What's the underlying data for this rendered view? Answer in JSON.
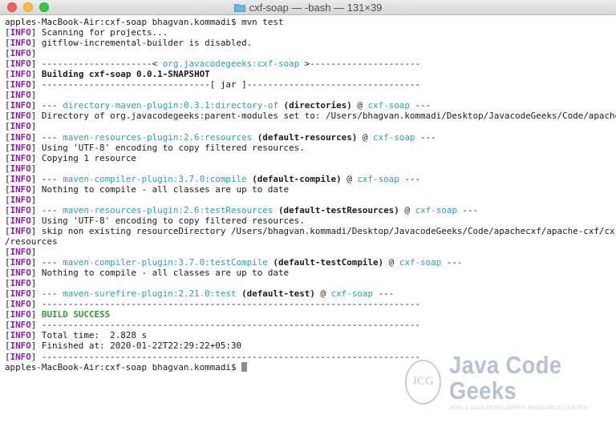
{
  "window": {
    "title": "cxf-soap — -bash — 131×39"
  },
  "terminal": {
    "lines": [
      [
        {
          "t": "apples-MacBook-Air:cxf-soap bhagvan.kommadi$ mvn test"
        }
      ],
      [
        {
          "t": "[",
          "c": "tag"
        },
        {
          "t": "INFO",
          "c": "tagb"
        },
        {
          "t": "] Scanning for projects..."
        }
      ],
      [
        {
          "t": "[",
          "c": "tag"
        },
        {
          "t": "INFO",
          "c": "tagb"
        },
        {
          "t": "] gitflow-incremental-builder is disabled."
        }
      ],
      [
        {
          "t": "[",
          "c": "tag"
        },
        {
          "t": "INFO",
          "c": "tagb"
        },
        {
          "t": "]"
        }
      ],
      [
        {
          "t": "[",
          "c": "tag"
        },
        {
          "t": "INFO",
          "c": "tagb"
        },
        {
          "t": "] ---------------------< "
        },
        {
          "t": "org.javacodegeeks:cxf-soap",
          "c": "cyan"
        },
        {
          "t": " >---------------------"
        }
      ],
      [
        {
          "t": "[",
          "c": "tag"
        },
        {
          "t": "INFO",
          "c": "tagb"
        },
        {
          "t": "] "
        },
        {
          "t": "Building cxf-soap 0.0.1-SNAPSHOT",
          "c": "bold"
        }
      ],
      [
        {
          "t": "[",
          "c": "tag"
        },
        {
          "t": "INFO",
          "c": "tagb"
        },
        {
          "t": "] --------------------------------[ jar ]---------------------------------"
        }
      ],
      [
        {
          "t": "[",
          "c": "tag"
        },
        {
          "t": "INFO",
          "c": "tagb"
        },
        {
          "t": "]"
        }
      ],
      [
        {
          "t": "[",
          "c": "tag"
        },
        {
          "t": "INFO",
          "c": "tagb"
        },
        {
          "t": "] --- "
        },
        {
          "t": "directory-maven-plugin:0.3.1:directory-of",
          "c": "cyan"
        },
        {
          "t": " "
        },
        {
          "t": "(directories)",
          "c": "bold"
        },
        {
          "t": " @ "
        },
        {
          "t": "cxf-soap",
          "c": "cyan"
        },
        {
          "t": " ---"
        }
      ],
      [
        {
          "t": "[",
          "c": "tag"
        },
        {
          "t": "INFO",
          "c": "tagb"
        },
        {
          "t": "] Directory of org.javacodegeeks:parent-modules set to: /Users/bhagvan.kommadi/Desktop/JavacodeGeeks/Code/apache"
        }
      ],
      [
        {
          "t": "[",
          "c": "tag"
        },
        {
          "t": "INFO",
          "c": "tagb"
        },
        {
          "t": "]"
        }
      ],
      [
        {
          "t": "[",
          "c": "tag"
        },
        {
          "t": "INFO",
          "c": "tagb"
        },
        {
          "t": "] --- "
        },
        {
          "t": "maven-resources-plugin:2.6:resources",
          "c": "cyan"
        },
        {
          "t": " "
        },
        {
          "t": "(default-resources)",
          "c": "bold"
        },
        {
          "t": " @ "
        },
        {
          "t": "cxf-soap",
          "c": "cyan"
        },
        {
          "t": " ---"
        }
      ],
      [
        {
          "t": "[",
          "c": "tag"
        },
        {
          "t": "INFO",
          "c": "tagb"
        },
        {
          "t": "] Using 'UTF-8' encoding to copy filtered resources."
        }
      ],
      [
        {
          "t": "[",
          "c": "tag"
        },
        {
          "t": "INFO",
          "c": "tagb"
        },
        {
          "t": "] Copying 1 resource"
        }
      ],
      [
        {
          "t": "[",
          "c": "tag"
        },
        {
          "t": "INFO",
          "c": "tagb"
        },
        {
          "t": "]"
        }
      ],
      [
        {
          "t": "[",
          "c": "tag"
        },
        {
          "t": "INFO",
          "c": "tagb"
        },
        {
          "t": "] --- "
        },
        {
          "t": "maven-compiler-plugin:3.7.0:compile",
          "c": "cyan"
        },
        {
          "t": " "
        },
        {
          "t": "(default-compile)",
          "c": "bold"
        },
        {
          "t": " @ "
        },
        {
          "t": "cxf-soap",
          "c": "cyan"
        },
        {
          "t": " ---"
        }
      ],
      [
        {
          "t": "[",
          "c": "tag"
        },
        {
          "t": "INFO",
          "c": "tagb"
        },
        {
          "t": "] Nothing to compile - all classes are up to date"
        }
      ],
      [
        {
          "t": "[",
          "c": "tag"
        },
        {
          "t": "INFO",
          "c": "tagb"
        },
        {
          "t": "]"
        }
      ],
      [
        {
          "t": "[",
          "c": "tag"
        },
        {
          "t": "INFO",
          "c": "tagb"
        },
        {
          "t": "] --- "
        },
        {
          "t": "maven-resources-plugin:2.6:testResources",
          "c": "cyan"
        },
        {
          "t": " "
        },
        {
          "t": "(default-testResources)",
          "c": "bold"
        },
        {
          "t": " @ "
        },
        {
          "t": "cxf-soap",
          "c": "cyan"
        },
        {
          "t": " ---"
        }
      ],
      [
        {
          "t": "[",
          "c": "tag"
        },
        {
          "t": "INFO",
          "c": "tagb"
        },
        {
          "t": "] Using 'UTF-8' encoding to copy filtered resources."
        }
      ],
      [
        {
          "t": "[",
          "c": "tag"
        },
        {
          "t": "INFO",
          "c": "tagb"
        },
        {
          "t": "] skip non existing resourceDirectory /Users/bhagvan.kommadi/Desktop/JavacodeGeeks/Code/apachecxf/apache-cxf/cx"
        }
      ],
      [
        {
          "t": "/resources"
        }
      ],
      [
        {
          "t": "[",
          "c": "tag"
        },
        {
          "t": "INFO",
          "c": "tagb"
        },
        {
          "t": "]"
        }
      ],
      [
        {
          "t": "[",
          "c": "tag"
        },
        {
          "t": "INFO",
          "c": "tagb"
        },
        {
          "t": "] --- "
        },
        {
          "t": "maven-compiler-plugin:3.7.0:testCompile",
          "c": "cyan"
        },
        {
          "t": " "
        },
        {
          "t": "(default-testCompile)",
          "c": "bold"
        },
        {
          "t": " @ "
        },
        {
          "t": "cxf-soap",
          "c": "cyan"
        },
        {
          "t": " ---"
        }
      ],
      [
        {
          "t": "[",
          "c": "tag"
        },
        {
          "t": "INFO",
          "c": "tagb"
        },
        {
          "t": "] Nothing to compile - all classes are up to date"
        }
      ],
      [
        {
          "t": "[",
          "c": "tag"
        },
        {
          "t": "INFO",
          "c": "tagb"
        },
        {
          "t": "]"
        }
      ],
      [
        {
          "t": "[",
          "c": "tag"
        },
        {
          "t": "INFO",
          "c": "tagb"
        },
        {
          "t": "] --- "
        },
        {
          "t": "maven-surefire-plugin:2.21.0:test",
          "c": "cyan"
        },
        {
          "t": " "
        },
        {
          "t": "(default-test)",
          "c": "bold"
        },
        {
          "t": " @ "
        },
        {
          "t": "cxf-soap",
          "c": "cyan"
        },
        {
          "t": " ---"
        }
      ],
      [
        {
          "t": "[",
          "c": "tag"
        },
        {
          "t": "INFO",
          "c": "tagb"
        },
        {
          "t": "] ------------------------------------------------------------------------"
        }
      ],
      [
        {
          "t": "[",
          "c": "tag"
        },
        {
          "t": "INFO",
          "c": "tagb"
        },
        {
          "t": "] "
        },
        {
          "t": "BUILD SUCCESS",
          "c": "green"
        }
      ],
      [
        {
          "t": "[",
          "c": "tag"
        },
        {
          "t": "INFO",
          "c": "tagb"
        },
        {
          "t": "] ------------------------------------------------------------------------"
        }
      ],
      [
        {
          "t": "[",
          "c": "tag"
        },
        {
          "t": "INFO",
          "c": "tagb"
        },
        {
          "t": "] Total time:  2.828 s"
        }
      ],
      [
        {
          "t": "[",
          "c": "tag"
        },
        {
          "t": "INFO",
          "c": "tagb"
        },
        {
          "t": "] Finished at: 2020-01-22T22:29:22+05:30"
        }
      ],
      [
        {
          "t": "[",
          "c": "tag"
        },
        {
          "t": "INFO",
          "c": "tagb"
        },
        {
          "t": "] ------------------------------------------------------------------------"
        }
      ],
      [
        {
          "t": "apples-MacBook-Air:cxf-soap bhagvan.kommadi$ "
        },
        {
          "t": "",
          "c": "cursor"
        }
      ]
    ]
  },
  "watermark": {
    "badge": "JCG",
    "title": "Java Code Geeks",
    "subtitle": "JAVA 2 JAVA DEVELOPERS RESOURCE CENTER"
  },
  "colors": {
    "tag": "#8a1fa8",
    "cyan": "#2aa1b3",
    "success": "#2e9c35"
  },
  "icons": {
    "folder": "folder-icon"
  }
}
